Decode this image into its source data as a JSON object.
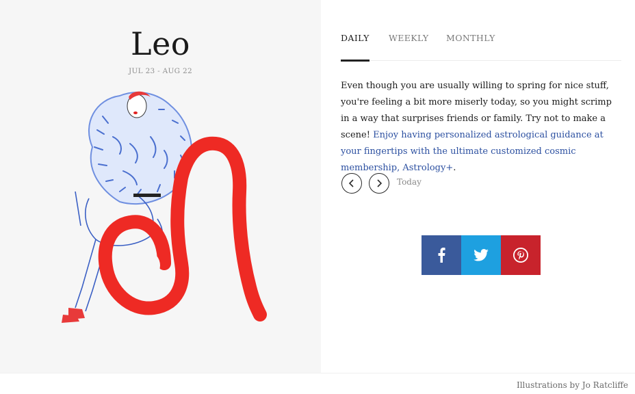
{
  "sign": {
    "name": "Leo",
    "dates": "JUL 23 - AUG 22"
  },
  "tabs": [
    {
      "label": "DAILY",
      "active": true
    },
    {
      "label": "WEEKLY",
      "active": false
    },
    {
      "label": "MONTHLY",
      "active": false
    }
  ],
  "horoscope": {
    "text": "Even though you are usually willing to spring for nice stuff, you're feeling a bit more miserly today, so you might scrimp in a way that surprises friends or family. Try not to make a scene! ",
    "link_text": "Enjoy having personalized astrological guidance at your fingertips with the ultimate customized cosmic membership, Astrology+",
    "trailing": "."
  },
  "navigation": {
    "prev_icon": "chevron-left-icon",
    "next_icon": "chevron-right-icon",
    "label": "Today"
  },
  "share": {
    "facebook_icon": "facebook-icon",
    "twitter_icon": "twitter-icon",
    "pinterest_icon": "pinterest-icon",
    "colors": {
      "facebook": "#3a5a9b",
      "twitter": "#1ea0e0",
      "pinterest": "#c8232c"
    }
  },
  "footer": {
    "credit": "Illustrations by Jo Ratcliffe"
  },
  "colors": {
    "link": "#2b4fa0",
    "glyph_red": "#ee2a24",
    "left_bg": "#f6f6f6"
  }
}
